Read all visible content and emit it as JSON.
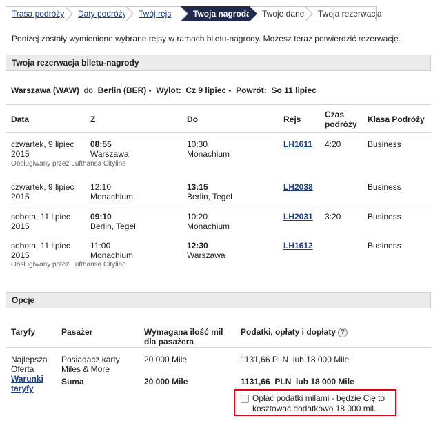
{
  "steps": [
    {
      "label": "Trasa podróży"
    },
    {
      "label": "Daty podróży"
    },
    {
      "label": "Twój rejs"
    },
    {
      "label": "Twoja nagroda"
    },
    {
      "label": "Twoje dane"
    },
    {
      "label": "Twoja rezerwacja"
    }
  ],
  "intro": "Poniżej zostały wymienione wybrane rejsy w ramach biletu-nagrody. Możesz teraz potwierdzić rezerwację.",
  "reservation": {
    "heading": "Twoja rezerwacja biletu-nagrody",
    "route": {
      "origin": "Warszawa (WAW)",
      "to": "do",
      "destination": "Berlin (BER)",
      "departure_label": "Wylot:",
      "departure_date": "Cz 9 lipiec",
      "return_label": "Powrót:",
      "return_date": "So 11 lipiec"
    },
    "columns": {
      "date": "Data",
      "from": "Z",
      "to": "Do",
      "flight": "Rejs",
      "duration": "Czas podróży",
      "class": "Klasa Podróży"
    },
    "flights": [
      {
        "date": "czwartek, 9 lipiec 2015",
        "dep_time": "08:55",
        "dep_city": "Warszawa",
        "arr_time": "10:30",
        "arr_city": "Monachium",
        "flight": "LH1611",
        "duration": "4:20",
        "class": "Business",
        "operated_by": "Obsługiwany przez Lufthansa Cityline"
      },
      {
        "date": "czwartek, 9 lipiec 2015",
        "dep_time": "12:10",
        "dep_city": "Monachium",
        "arr_time": "13:15",
        "arr_city": "Berlin, Tegel",
        "flight": "LH2038",
        "duration": "",
        "class": "Business",
        "operated_by": ""
      },
      {
        "date": "sobota, 11 lipiec 2015",
        "dep_time": "09:10",
        "dep_city": "Berlin, Tegel",
        "arr_time": "10:20",
        "arr_city": "Monachium",
        "flight": "LH2031",
        "duration": "3:20",
        "class": "Business",
        "operated_by": ""
      },
      {
        "date": "sobota, 11 lipiec 2015",
        "dep_time": "11:00",
        "dep_city": "Monachium",
        "arr_time": "12:30",
        "arr_city": "Warszawa",
        "flight": "LH1612",
        "duration": "",
        "class": "Business",
        "operated_by": "Obsługiwany przez Lufthansa Cityline"
      }
    ]
  },
  "options": {
    "heading": "Opcje",
    "columns": {
      "fares": "Taryfy",
      "passenger": "Pasażer",
      "miles_required": "Wymagana ilość mil dla pasażera",
      "taxes": "Podatki, opłaty i dopłaty",
      "help_icon": "?"
    },
    "fare_name": "Najlepsza Oferta",
    "fare_rules_link": "Warunki taryfy",
    "passenger": "Posiadacz karty Miles & More",
    "miles": "20 000 Mile",
    "taxes": "1131,66 PLN  lub 18 000 Mile",
    "sum_label": "Suma",
    "sum_miles": "20 000 Mile",
    "sum_taxes": "1131,66  PLN  lub 18 000 Mile",
    "pay_with_miles_label": "Opłać podatki milami - będzie Cię to kosztować dodatkowo 18 000 mil."
  },
  "colors": {
    "active_step": "#1f2a4d",
    "link": "#1a3f8a",
    "highlight": "#e3001b"
  }
}
